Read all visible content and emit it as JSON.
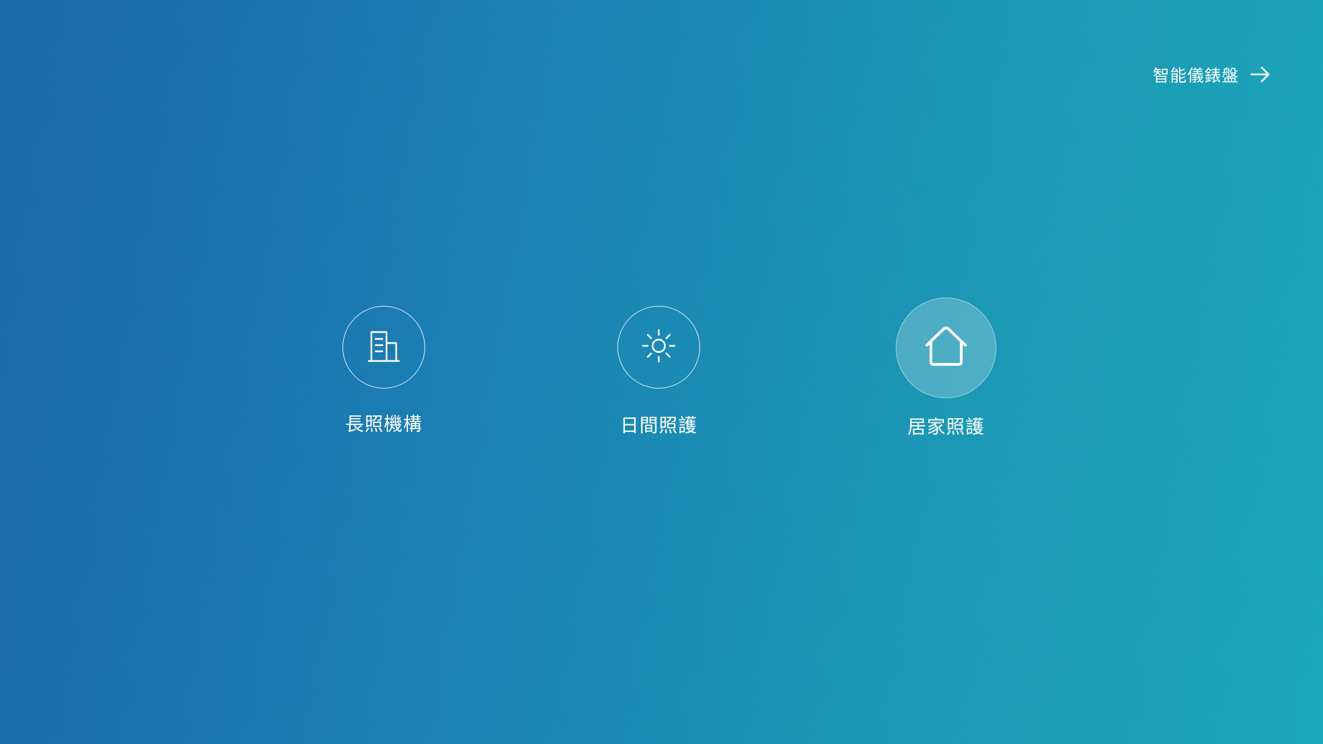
{
  "header": {
    "dashboard_label": "智能儀錶盤",
    "dashboard_icon": "arrow-right-icon"
  },
  "options": [
    {
      "label": "長照機構",
      "icon": "building-icon",
      "selected": false
    },
    {
      "label": "日間照護",
      "icon": "sun-icon",
      "selected": false
    },
    {
      "label": "居家照護",
      "icon": "home-icon",
      "selected": true
    }
  ],
  "colors": {
    "background_start": "#1768a8",
    "background_end": "#1aa8bb",
    "foreground": "#ffffff"
  }
}
